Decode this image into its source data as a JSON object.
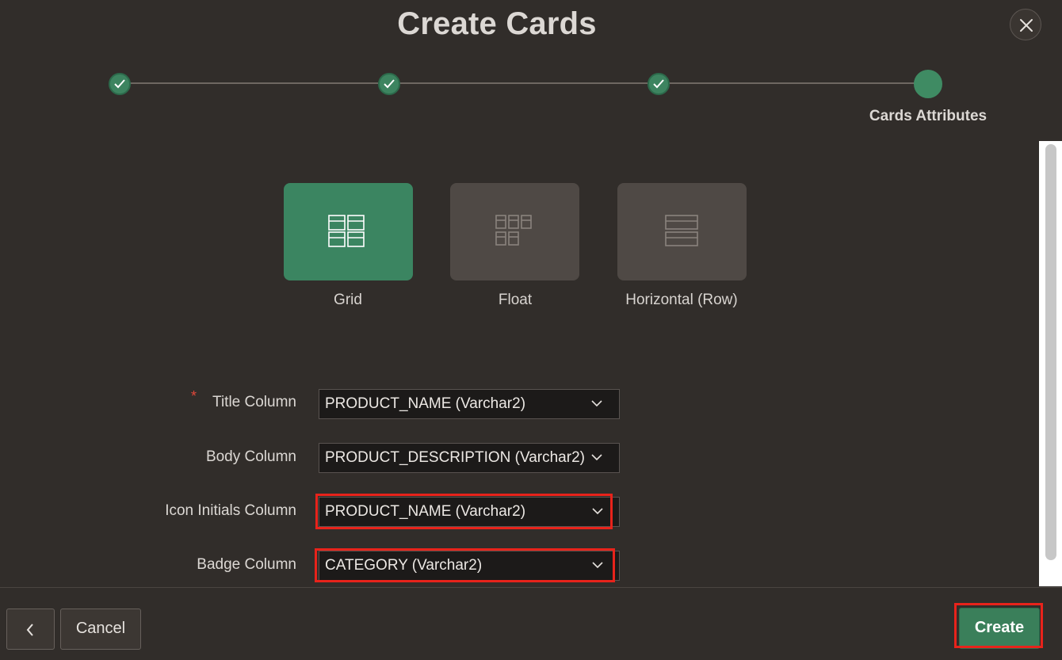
{
  "dialog": {
    "title": "Create Cards",
    "close_icon": "close-icon"
  },
  "wizard": {
    "steps": [
      {
        "status": "complete",
        "icon": "check-icon"
      },
      {
        "status": "complete",
        "icon": "check-icon"
      },
      {
        "status": "complete",
        "icon": "check-icon"
      },
      {
        "status": "current",
        "label": "Cards Attributes"
      }
    ]
  },
  "layouts": [
    {
      "label": "Grid",
      "icon": "grid-layout-icon",
      "selected": true
    },
    {
      "label": "Float",
      "icon": "float-layout-icon",
      "selected": false
    },
    {
      "label": "Horizontal (Row)",
      "icon": "horizontal-row-layout-icon",
      "selected": false
    }
  ],
  "form": {
    "fields": [
      {
        "label": "Title Column",
        "required": true,
        "value": "PRODUCT_NAME (Varchar2)"
      },
      {
        "label": "Body Column",
        "required": false,
        "value": "PRODUCT_DESCRIPTION (Varchar2)"
      },
      {
        "label": "Icon Initials Column",
        "required": false,
        "value": "PRODUCT_NAME (Varchar2)",
        "highlighted": true
      },
      {
        "label": "Badge Column",
        "required": false,
        "value": "CATEGORY (Varchar2)",
        "highlighted": true
      }
    ],
    "required_marker": "*"
  },
  "footer": {
    "back_icon": "chevron-left-icon",
    "cancel_label": "Cancel",
    "create_label": "Create",
    "create_highlighted": true
  },
  "colors": {
    "background": "#312d2a",
    "accent_green": "#3b8561",
    "highlight_red": "#e8231b"
  }
}
